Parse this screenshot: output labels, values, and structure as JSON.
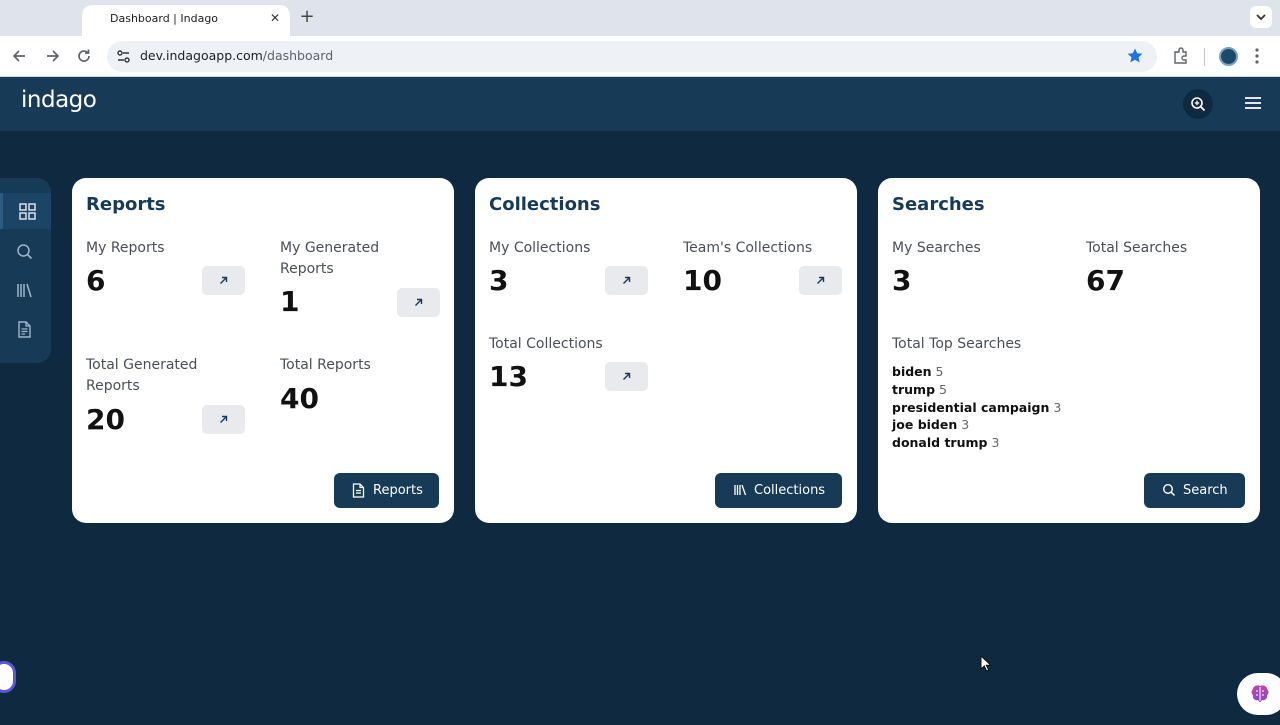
{
  "browser": {
    "tab_title": "Dashboard | Indago",
    "url_host": "dev.indagoapp.com",
    "url_path": "/dashboard"
  },
  "app": {
    "logo": "indago"
  },
  "sidebar": {
    "items": [
      {
        "icon": "dashboard-icon",
        "active": true
      },
      {
        "icon": "search-icon",
        "active": false
      },
      {
        "icon": "library-icon",
        "active": false
      },
      {
        "icon": "document-icon",
        "active": false
      }
    ]
  },
  "reports": {
    "title": "Reports",
    "my_reports_label": "My Reports",
    "my_reports_value": "6",
    "my_generated_label": "My Generated Reports",
    "my_generated_value": "1",
    "total_generated_label": "Total Generated Reports",
    "total_generated_value": "20",
    "total_reports_label": "Total Reports",
    "total_reports_value": "40",
    "button_label": "Reports"
  },
  "collections": {
    "title": "Collections",
    "my_collections_label": "My Collections",
    "my_collections_value": "3",
    "team_collections_label": "Team's Collections",
    "team_collections_value": "10",
    "total_collections_label": "Total Collections",
    "total_collections_value": "13",
    "button_label": "Collections"
  },
  "searches": {
    "title": "Searches",
    "my_searches_label": "My Searches",
    "my_searches_value": "3",
    "total_searches_label": "Total Searches",
    "total_searches_value": "67",
    "top_searches_label": "Total Top Searches",
    "top_searches": [
      {
        "term": "biden",
        "count": "5"
      },
      {
        "term": "trump",
        "count": "5"
      },
      {
        "term": "presidential campaign",
        "count": "3"
      },
      {
        "term": "joe biden",
        "count": "3"
      },
      {
        "term": "donald trump",
        "count": "3"
      }
    ],
    "button_label": "Search"
  },
  "colors": {
    "page_bg": "#0f2a40",
    "header_bg": "#173b57",
    "primary": "#173b57",
    "card_bg": "#ffffff"
  }
}
